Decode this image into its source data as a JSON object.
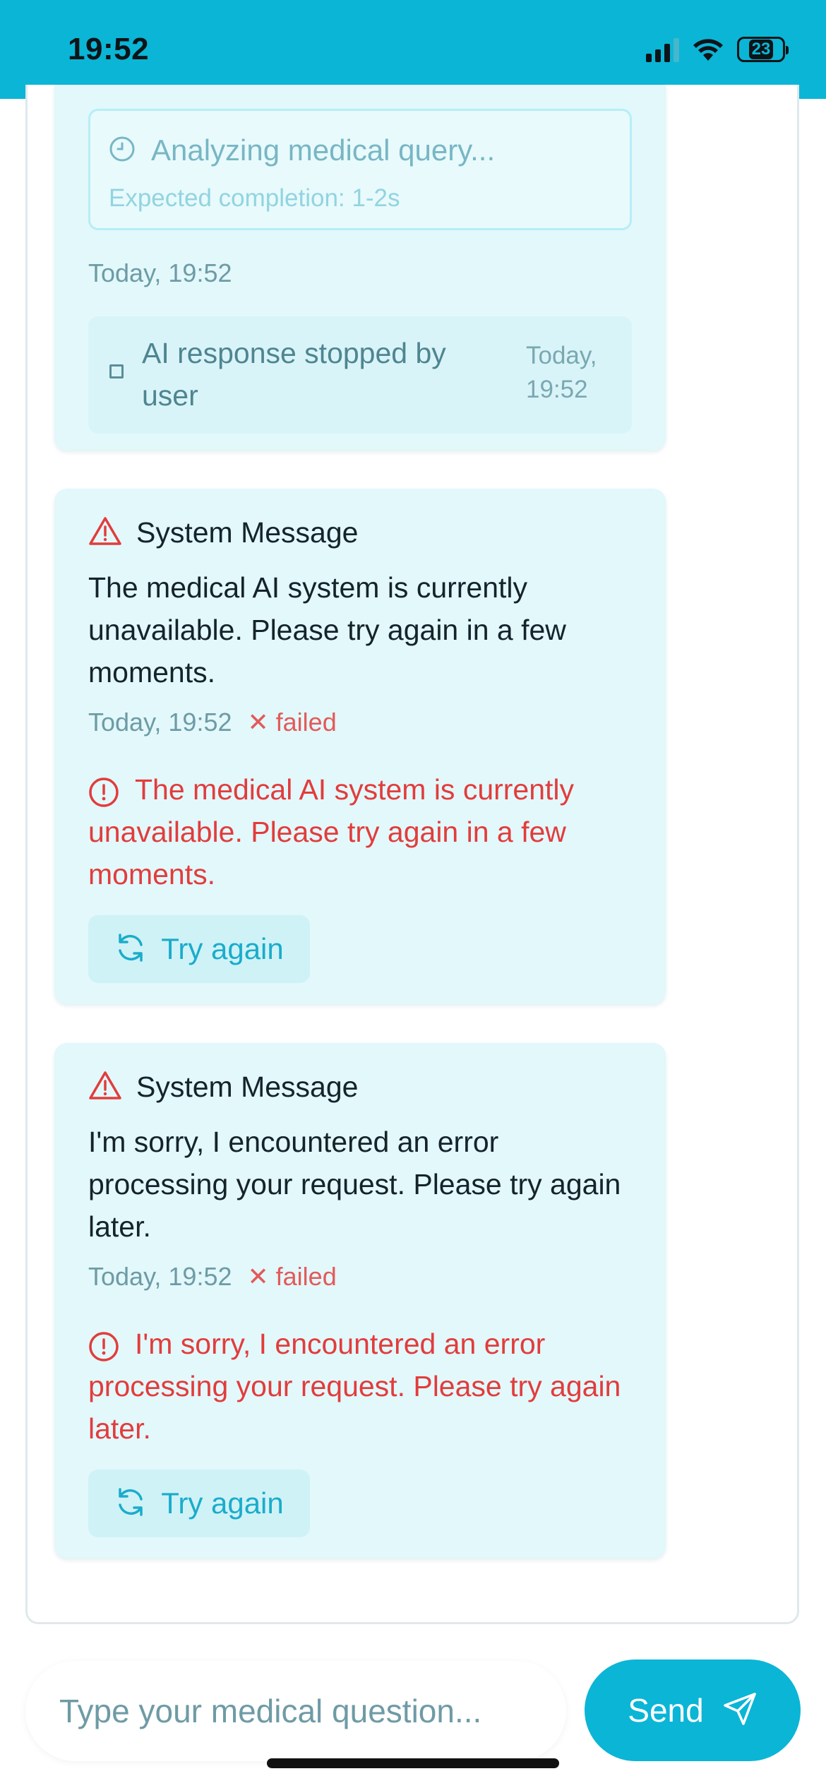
{
  "status_bar": {
    "time": "19:52",
    "battery_level": "23"
  },
  "messages": {
    "analyzing": {
      "label": "Analyzing medical query...",
      "expected": "Expected completion: 1-2s",
      "timestamp": "Today, 19:52"
    },
    "stopped": {
      "label": "AI response stopped by user",
      "timestamp": "Today, 19:52"
    },
    "system_1": {
      "title": "System Message",
      "body": "The medical AI system is currently unavailable. Please try again in a few moments.",
      "timestamp": "Today, 19:52",
      "status": "failed",
      "error": "The medical AI system is currently unavailable. Please try again in a few moments.",
      "retry_label": "Try again"
    },
    "system_2": {
      "title": "System Message",
      "body": "I'm sorry, I encountered an error processing your request. Please try again later.",
      "timestamp": "Today, 19:52",
      "status": "failed",
      "error": "I'm sorry, I encountered an error processing your request. Please try again later.",
      "retry_label": "Try again"
    }
  },
  "composer": {
    "placeholder": "Type your medical question...",
    "send_label": "Send"
  },
  "colors": {
    "accent": "#0bb5d6",
    "card_bg": "#e2f8fb",
    "error": "#e23c3c"
  }
}
